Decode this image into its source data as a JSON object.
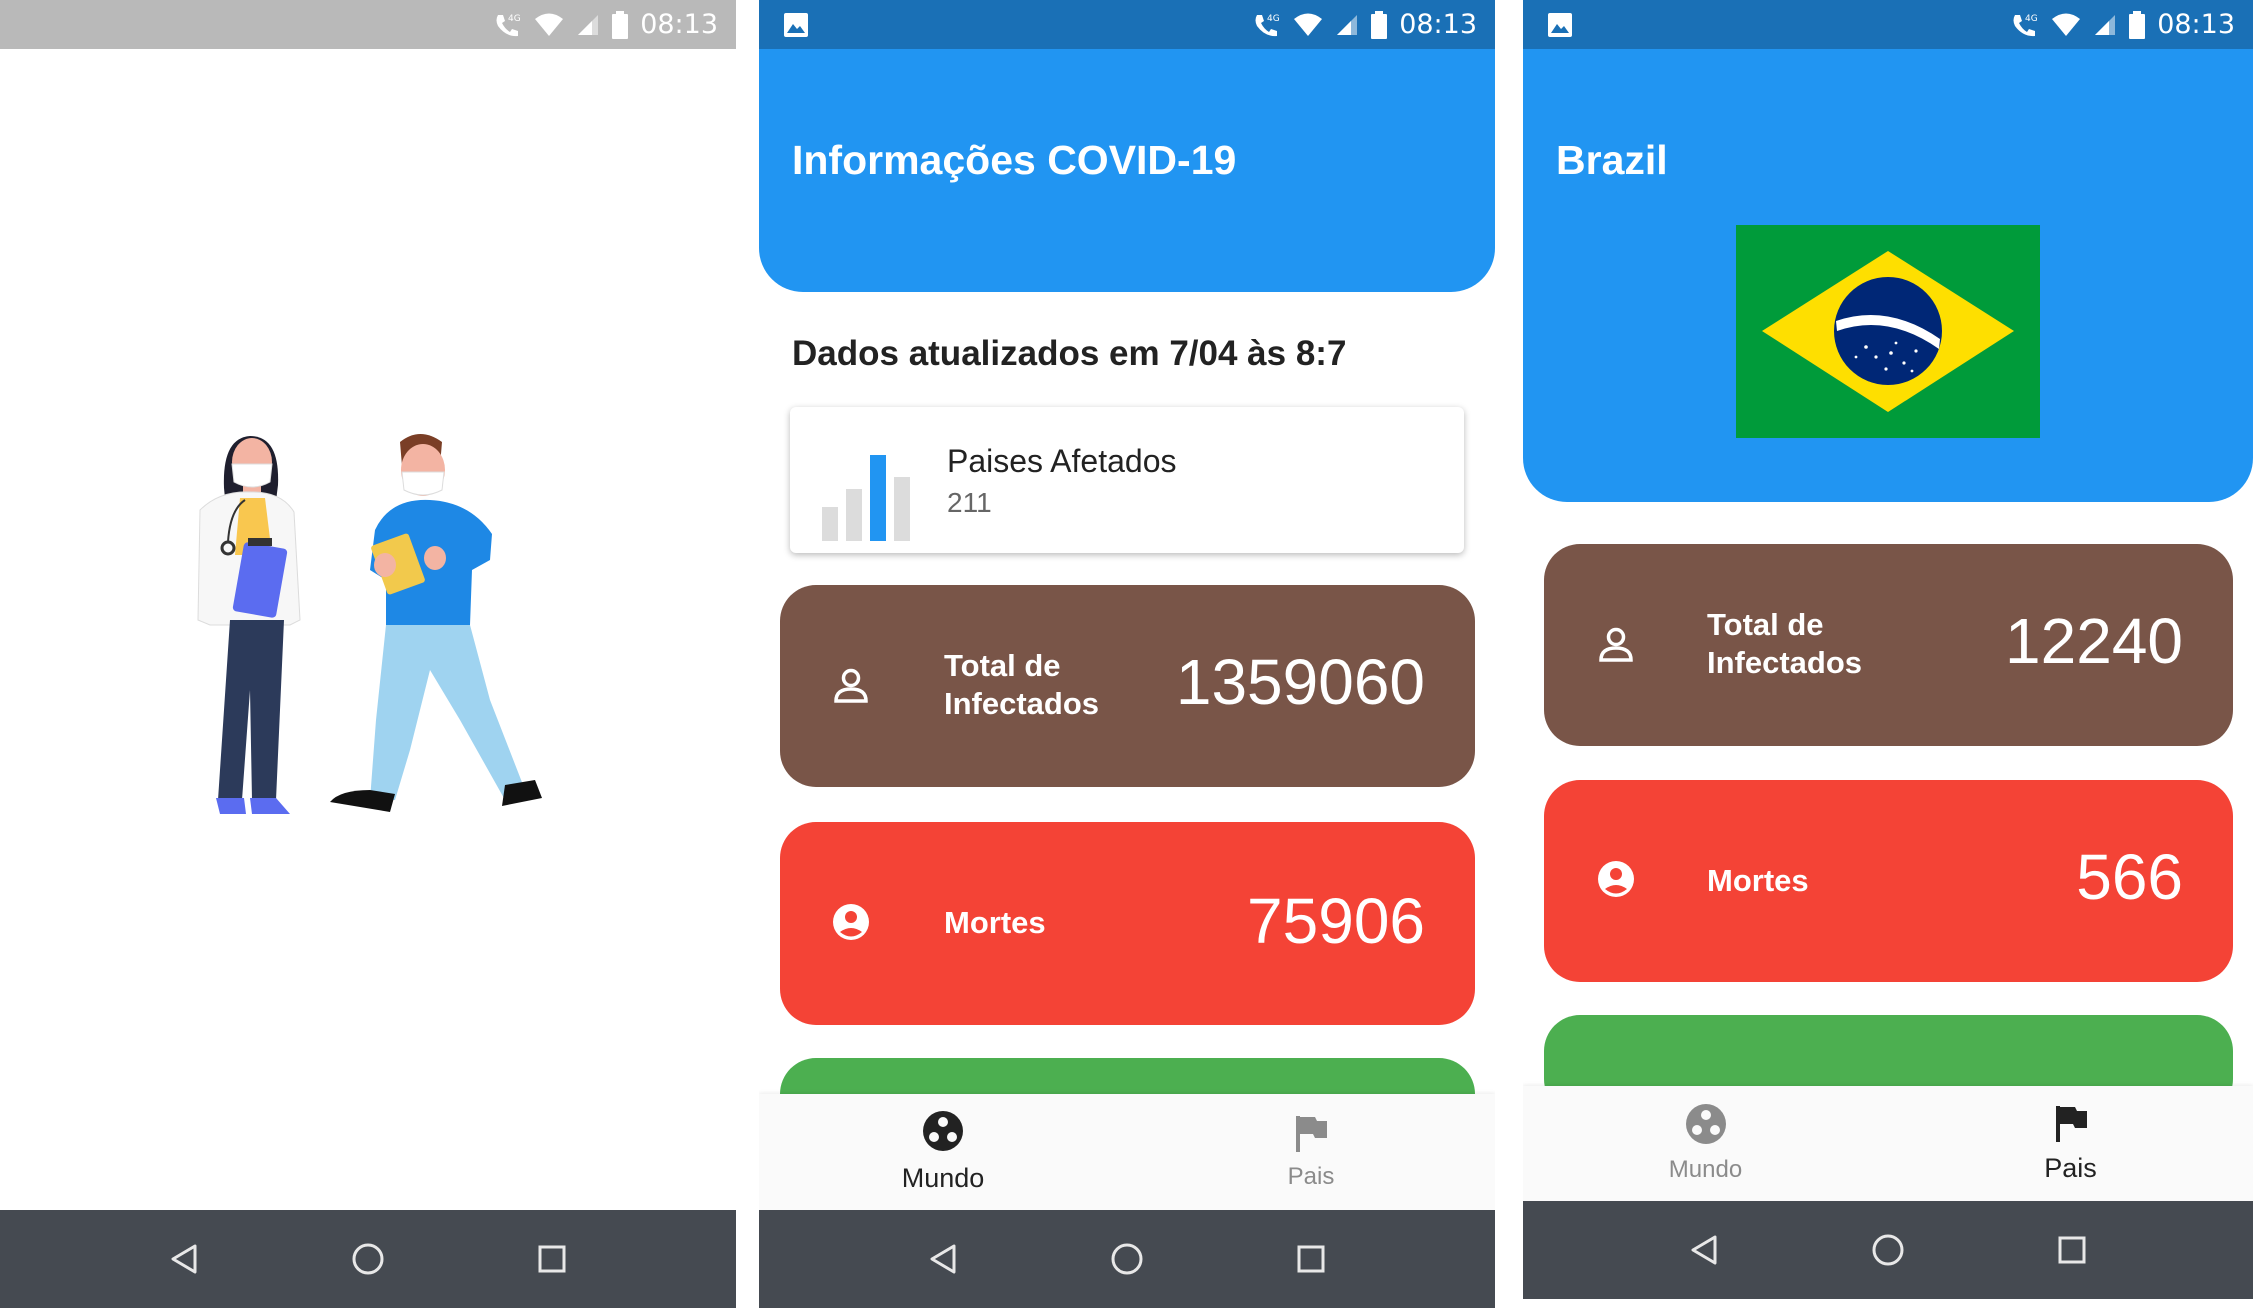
{
  "status": {
    "time": "08:13",
    "network": "4G"
  },
  "splash": {},
  "world": {
    "title": "Informações COVID-19",
    "updated": "Dados atualizados em 7/04 às 8:7",
    "countries_card": {
      "label": "Paises Afetados",
      "value": "211"
    },
    "cards": [
      {
        "label_line1": "Total de",
        "label_line2": "Infectados",
        "value": "1359060",
        "color": "#795548"
      },
      {
        "label": "Mortes",
        "value": "75906",
        "color": "#f44336"
      }
    ],
    "next_card_color": "#4caf50"
  },
  "country": {
    "title": "Brazil",
    "cards": [
      {
        "label_line1": "Total de",
        "label_line2": "Infectados",
        "value": "12240",
        "color": "#795548"
      },
      {
        "label": "Mortes",
        "value": "566",
        "color": "#f44336"
      }
    ],
    "next_card_color": "#4caf50"
  },
  "bottom_nav": {
    "world_label": "Mundo",
    "country_label": "Pais"
  },
  "colors": {
    "header_blue": "#2195f2",
    "status_blue": "#1a70b6",
    "nav_dark": "#454a51"
  },
  "icons": [
    "android-back-icon",
    "android-home-icon",
    "android-recents-icon",
    "person-outline-icon",
    "account-circle-icon",
    "globe-icon",
    "flag-icon",
    "bar-chart-icon",
    "gallery-notification-icon"
  ]
}
